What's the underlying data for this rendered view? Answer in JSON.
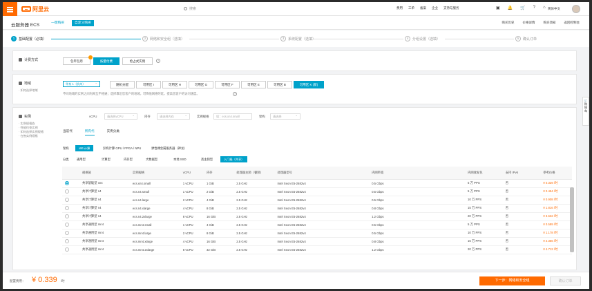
{
  "topbar": {
    "logo": "阿里云",
    "search_placeholder": "搜索",
    "nav": [
      "费用",
      "工单",
      "备案",
      "企业",
      "支持与服务"
    ],
    "icons": [
      "▣",
      "🔔",
      "🛒",
      "?",
      "⌂"
    ],
    "account": "简体中文"
  },
  "subbar": {
    "title": "云服务器 ECS",
    "tab_basic": "一键购买",
    "tab_custom": "自定义购买",
    "actions": [
      "购买历史",
      "价格详情",
      "购买须知",
      "返回控制台"
    ]
  },
  "steps": [
    {
      "num": "1",
      "label": "基础配置（必填）"
    },
    {
      "num": "2",
      "label": "网络和安全组（选填）"
    },
    {
      "num": "3",
      "label": "系统配置（选填）"
    },
    {
      "num": "4",
      "label": "分组设置（选填）"
    },
    {
      "num": "5",
      "label": "确认订单"
    }
  ],
  "billing": {
    "title": "计费方式",
    "options": [
      "包年包月",
      "按量付费",
      "抢占式实例"
    ]
  },
  "region": {
    "title": "地域",
    "desc": "· 如何选择地域",
    "select": "华东 1（杭州）",
    "zones": [
      "随机分配",
      "可用区 I",
      "可用区 H",
      "可用区 G",
      "可用区 F",
      "可用区 E",
      "可用区 B",
      "可用区 K (新)"
    ],
    "note": "不同地域的实例之间内网互不相通；选择靠近您客户的地域，可降低网络时延，提高您客户的访问速度。"
  },
  "instance": {
    "title": "实例",
    "desc_lines": [
      "· 实例规格族",
      "· 性能约束实例",
      "· 如何选择实例规格",
      "· 在售实例规格"
    ],
    "filters": {
      "vcpu_label": "vCPU",
      "vcpu_ph": "请选择vCPU",
      "mem_label": "内存",
      "mem_ph": "请选择内存",
      "spec_label": "实例规格",
      "spec_ph": "如：ecs.xn4.small",
      "arch_label": "架构",
      "arch_ph": "请选择"
    },
    "tabs": [
      "当前代",
      "所有代",
      "实例分类"
    ],
    "arch_label": "架构",
    "arch_opts": [
      "x86 计算",
      "异构计算 GPU / FPGA / NPU",
      "弹性裸金属服务器（神龙）"
    ],
    "cat_label": "分类",
    "cat_opts": [
      "通用型",
      "计算型",
      "内存型",
      "大数据型",
      "本地 SSD",
      "高主频型",
      "入门级（共享）"
    ]
  },
  "table": {
    "headers": [
      "规格族",
      "实例规格",
      "vCPU",
      "内存",
      "处理器主频（睿频）",
      "处理器型号",
      "内网带宽",
      "内网收发包",
      "支持 IPv6",
      "参考价格"
    ],
    "rows": [
      [
        "共享基础型 xn4",
        "ecs.xn4.small",
        "1 vCPU",
        "1 GiB",
        "2.5 GHz",
        "Intel Xeon E5-2682v4",
        "0.5 Gbps",
        "5 万 PPS",
        "否",
        "¥ 0.339 /时"
      ],
      [
        "共享计算型 n4",
        "ecs.n4.small",
        "1 vCPU",
        "2 GiB",
        "2.5 GHz",
        "Intel Xeon E5-2682v4",
        "0.5 Gbps",
        "5 万 PPS",
        "否",
        "¥ 0.454 /时"
      ],
      [
        "共享计算型 n4",
        "ecs.n4.large",
        "2 vCPU",
        "4 GiB",
        "2.5 GHz",
        "Intel Xeon E5-2682v4",
        "0.5 Gbps",
        "10 万 PPS",
        "否",
        "¥ 0.908 /时"
      ],
      [
        "共享计算型 n4",
        "ecs.n4.xlarge",
        "4 vCPU",
        "8 GiB",
        "2.5 GHz",
        "Intel Xeon E5-2682v4",
        "0.8 Gbps",
        "15 万 PPS",
        "否",
        "¥ 1.816 /时"
      ],
      [
        "共享计算型 n4",
        "ecs.n4.2xlarge",
        "8 vCPU",
        "16 GiB",
        "2.5 GHz",
        "Intel Xeon E5-2682v4",
        "1.2 Gbps",
        "20 万 PPS",
        "否",
        "¥ 3.632 /时"
      ],
      [
        "共享通用型 mn4",
        "ecs.mn4.small",
        "1 vCPU",
        "4 GiB",
        "2.5 GHz",
        "Intel Xeon E5-2682v4",
        "0.5 Gbps",
        "5 万 PPS",
        "否",
        "¥ 0.589 /时"
      ],
      [
        "共享通用型 mn4",
        "ecs.mn4.large",
        "2 vCPU",
        "8 GiB",
        "2.5 GHz",
        "Intel Xeon E5-2682v4",
        "0.5 Gbps",
        "10 万 PPS",
        "否",
        "¥ 1.178 /时"
      ],
      [
        "共享通用型 mn4",
        "ecs.mn4.xlarge",
        "4 vCPU",
        "16 GiB",
        "2.5 GHz",
        "Intel Xeon E5-2682v4",
        "0.8 Gbps",
        "15 万 PPS",
        "否",
        "¥ 2.356 /时"
      ],
      [
        "共享通用型 mn4",
        "ecs.mn4.2xlarge",
        "8 vCPU",
        "32 GiB",
        "2.5 GHz",
        "Intel Xeon E5-2682v4",
        "1.2 Gbps",
        "20 万 PPS",
        "否",
        "¥ 4.712 /时"
      ]
    ]
  },
  "cart_label": "购物车",
  "footer": {
    "label": "配置费用：",
    "price": "¥ 0.339",
    "unit": "/时",
    "next": "下一步：网络和安全组",
    "confirm": "确认订单"
  }
}
